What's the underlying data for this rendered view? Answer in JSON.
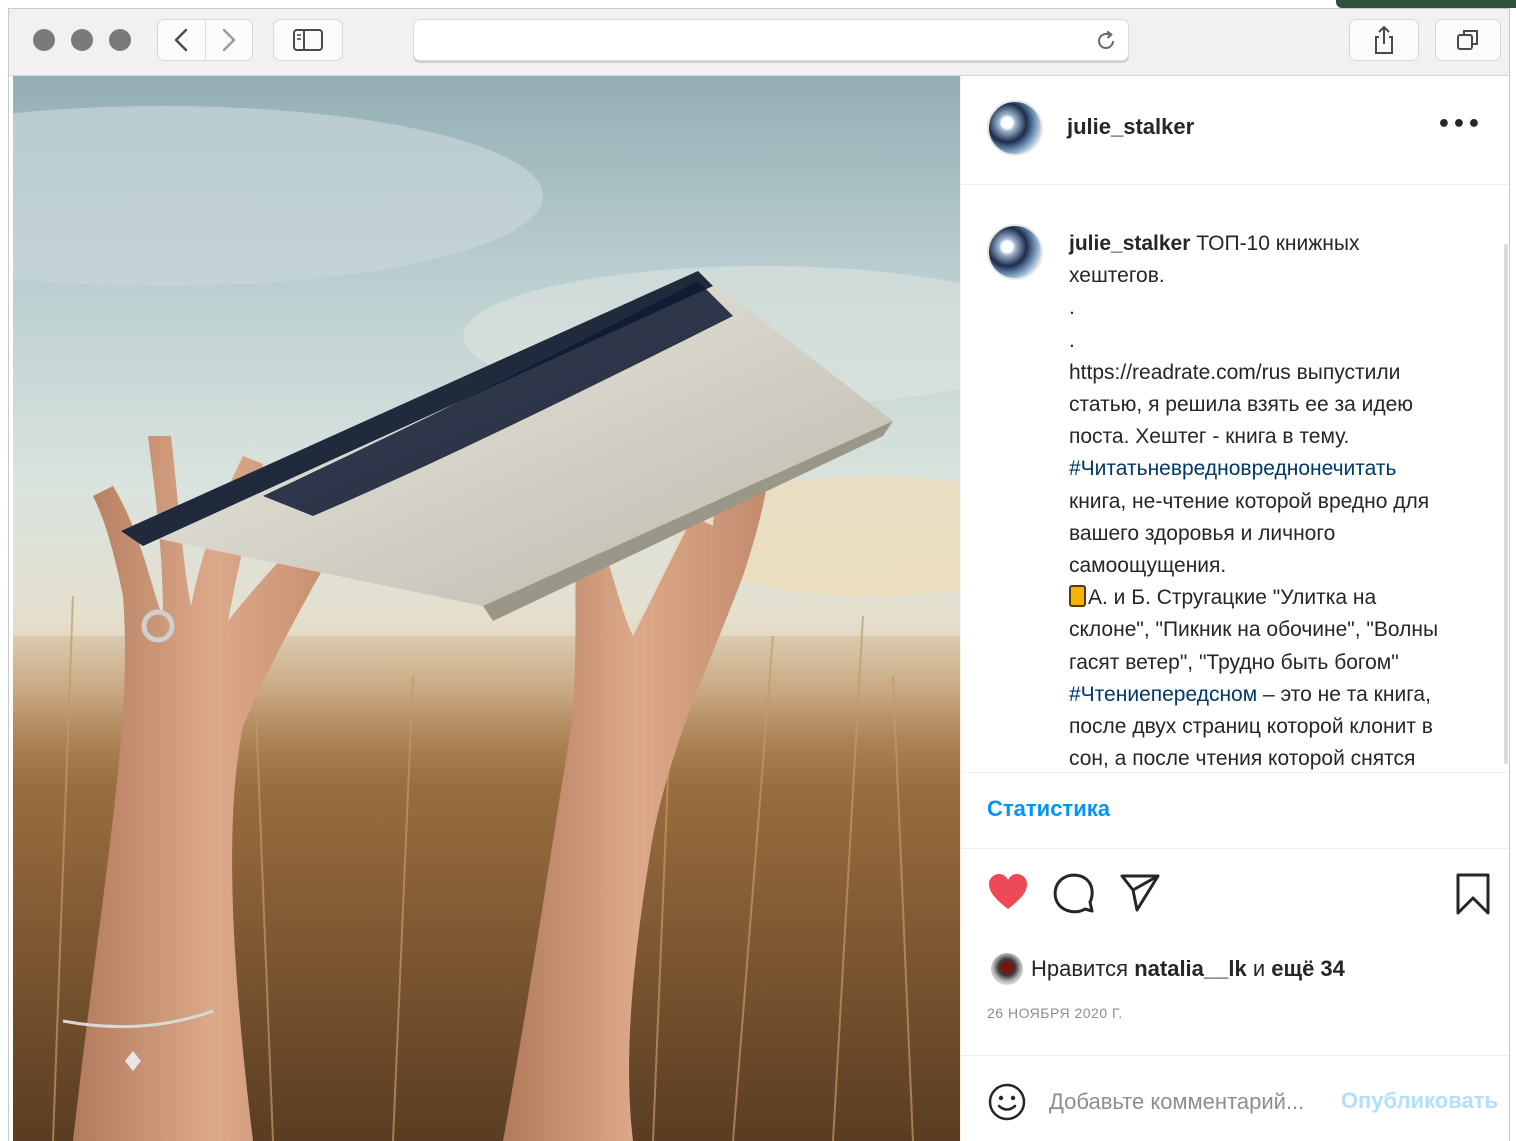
{
  "browser": {
    "address_url": "",
    "icons": [
      "back-icon",
      "forward-icon",
      "sidebar-icon",
      "reload-icon",
      "share-icon",
      "tabs-icon"
    ]
  },
  "post": {
    "author": "julie_stalker",
    "more_label": "•••",
    "caption_lines": [
      {
        "text": "ТОП-10 книжных",
        "with_user": true
      },
      {
        "text": "хештегов."
      },
      {
        "text": "."
      },
      {
        "text": "."
      },
      {
        "text": "https://readrate.com/rus выпустили"
      },
      {
        "text": "статью, я решила взять ее за идею"
      },
      {
        "text": "поста. Хештег - книга в тему."
      },
      {
        "hashtag": "#Читатьневредновреднонечитать"
      },
      {
        "text": "книга, не-чтение которой вредно для"
      },
      {
        "text": "вашего здоровья и личного"
      },
      {
        "text": "самоощущения."
      },
      {
        "text": "А. и Б. Стругацкие \"Улитка на",
        "emoji": "book-emoji"
      },
      {
        "text": "склоне\", \"Пикник на обочине\", \"Волны"
      },
      {
        "text": "гасят ветер\", \"Трудно быть богом\""
      },
      {
        "hashtag": "#Чтениепередсном",
        "text": " – это не та книга,"
      },
      {
        "text": "после двух страниц которой клонит в"
      },
      {
        "text": "сон, а после чтения которой снятся"
      }
    ],
    "stats_label": "Статистика",
    "likes": {
      "prefix": "Нравится",
      "user": "natalia__lk",
      "middle": "и",
      "rest": "ещё 34"
    },
    "date": "26 НОЯБРЯ 2020 Г.",
    "comment": {
      "placeholder": "Добавьте комментарий...",
      "value": ""
    },
    "publish_label": "Опубликовать",
    "colors": {
      "heart": "#ed4956",
      "link": "#0095f6",
      "hashtag": "#00376b",
      "publish_disabled": "#b2dffc"
    }
  }
}
